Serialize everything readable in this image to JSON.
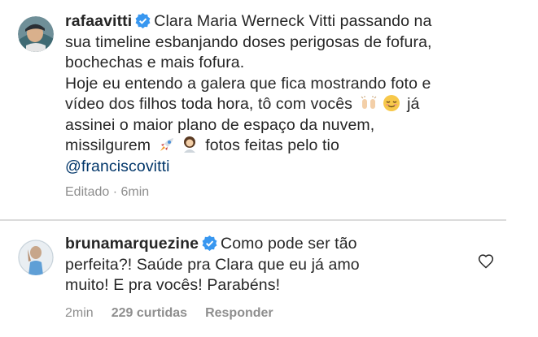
{
  "comments": [
    {
      "username": "rafaavitti",
      "verified": true,
      "lines": [
        "Clara Maria Werneck Vitti passando na",
        "sua timeline esbanjando doses perigosas de fofura,",
        "bochechas e mais fofura.",
        "Hoje eu entendo a galera que fica mostrando foto e",
        "vídeo dos filhos toda hora, tô com vocês",
        "já",
        "assinei o maior plano de espaço da nuvem,",
        "missilgurem",
        "fotos feitas pelo tio"
      ],
      "mention": "@franciscovitti",
      "meta": {
        "edited": "Editado · 6min"
      }
    },
    {
      "username": "brunamarquezine",
      "verified": true,
      "lines": [
        "Como pode ser tão",
        "perfeita?! Saúde pra Clara que eu já amo",
        "muito! E pra vocês! Parabéns!"
      ],
      "meta": {
        "time": "2min",
        "likes": "229 curtidas",
        "reply": "Responder"
      }
    }
  ],
  "icons": {
    "verified": "verified-badge-icon",
    "like": "heart-icon",
    "emoji_1": "raising-hands-emoji",
    "emoji_2": "relieved-face-emoji",
    "emoji_3": "rocket-emoji",
    "emoji_4": "woman-emoji"
  },
  "colors": {
    "text": "#262626",
    "meta": "#8e8e8e",
    "verified": "#3897f0",
    "mention": "#003569",
    "divider": "#dbdbdb"
  }
}
